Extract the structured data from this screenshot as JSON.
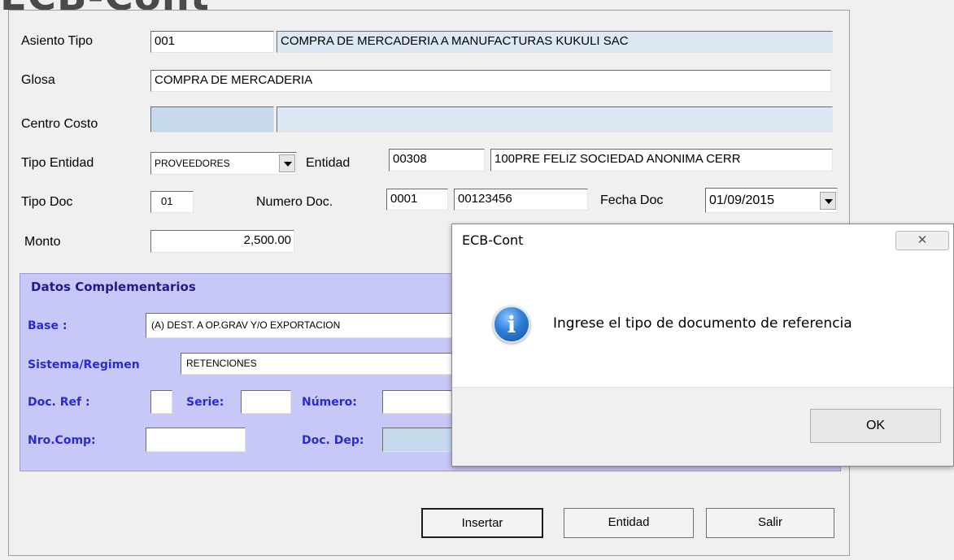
{
  "app_title": "ECB-Cont",
  "form": {
    "asiento_tipo_label": "Asiento Tipo",
    "asiento_tipo_code": "001",
    "asiento_tipo_desc": "COMPRA DE MERCADERIA A MANUFACTURAS KUKULI SAC",
    "glosa_label": "Glosa",
    "glosa_value": "COMPRA DE MERCADERIA",
    "centro_costo_label": "Centro Costo",
    "centro_costo_code": "",
    "centro_costo_desc": "",
    "tipo_entidad_label": "Tipo Entidad",
    "tipo_entidad_value": "PROVEEDORES",
    "entidad_label": "Entidad",
    "entidad_code": "00308",
    "entidad_name": "100PRE FELIZ SOCIEDAD ANONIMA CERR",
    "tipo_doc_label": "Tipo Doc",
    "tipo_doc_value": "01",
    "numero_doc_label": "Numero Doc.",
    "numero_doc_serie": "0001",
    "numero_doc_numero": "00123456",
    "fecha_doc_label": "Fecha Doc",
    "fecha_doc_value": "01/09/2015",
    "monto_label": "Monto",
    "monto_value": "2,500.00"
  },
  "complementarios": {
    "title": "Datos Complementarios",
    "base_label": "Base :",
    "base_value": "(A) DEST. A OP.GRAV Y/O EXPORTACION",
    "sistema_label": "Sistema/Regimen",
    "sistema_value": "RETENCIONES",
    "doc_ref_label": "Doc. Ref :",
    "doc_ref_value": "",
    "serie_label": "Serie:",
    "serie_value": "",
    "numero_label": "Número:",
    "numero_value": "",
    "nro_comp_label": "Nro.Comp:",
    "nro_comp_value": "",
    "doc_dep_label": "Doc. Dep:",
    "doc_dep_value": ""
  },
  "buttons": {
    "insertar": "Insertar",
    "entidad": "Entidad",
    "salir": "Salir"
  },
  "dialog": {
    "title": "ECB-Cont",
    "message": "Ingrese el tipo de documento de referencia",
    "ok_label": "OK",
    "icon": "info-icon"
  }
}
